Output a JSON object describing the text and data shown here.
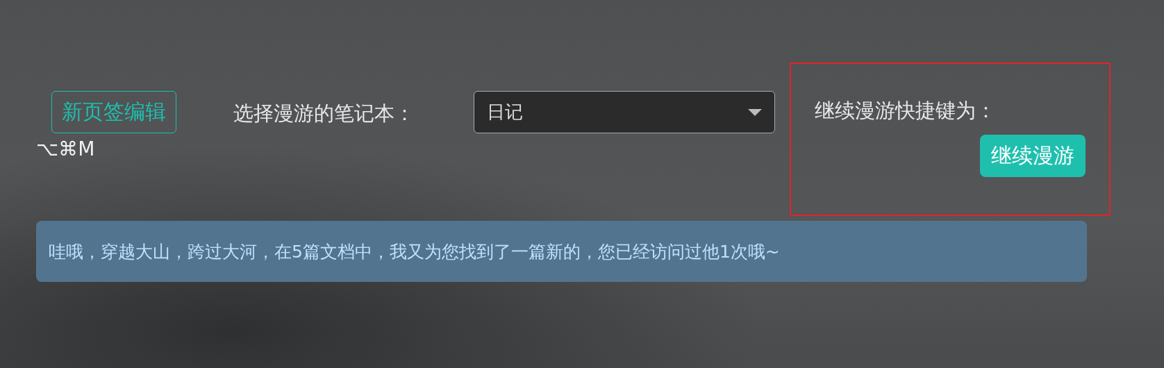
{
  "tab_edit_button": {
    "label": "新页签编辑"
  },
  "shortcut": "⌥⌘M",
  "notebook_label": "选择漫游的笔记本：",
  "notebook_select": {
    "value": "日记"
  },
  "continue_panel": {
    "label": "继续漫游快捷键为：",
    "button": "继续漫游"
  },
  "message": "哇哦，穿越大山，跨过大河，在5篇文档中，我又为您找到了一篇新的，您已经访问过他1次哦~"
}
